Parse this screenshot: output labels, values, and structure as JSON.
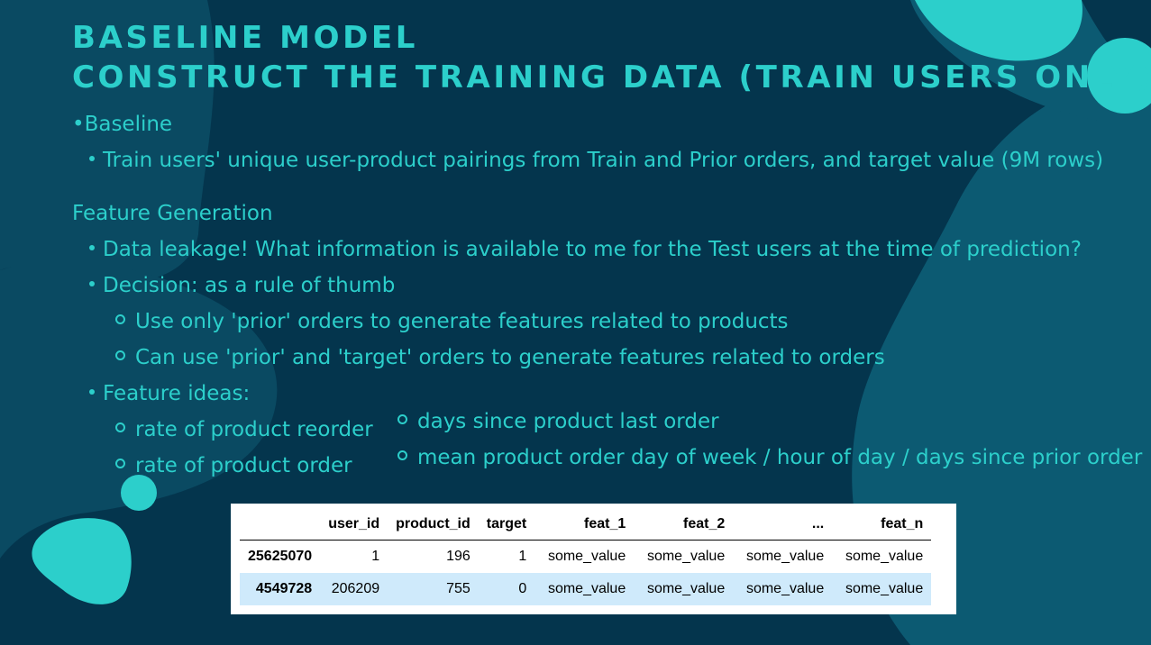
{
  "title": {
    "line1": "BASELINE MODEL",
    "line2": "CONSTRUCT THE TRAINING DATA (TRAIN USERS ONLY)"
  },
  "baseline": {
    "heading": "•Baseline",
    "item": "Train users' unique user-product pairings from Train and Prior orders, and target value (9M rows)"
  },
  "feature_generation": {
    "heading": "Feature Generation",
    "leakage": "Data leakage! What information is available to me for the Test users at the time of prediction?",
    "decision": "Decision: as a rule of thumb",
    "rule1": "Use only 'prior' orders to generate features related to products",
    "rule2": "Can use 'prior' and 'target' orders to generate features related to orders",
    "ideas_label": "Feature ideas:",
    "ideas_left": [
      "rate of product reorder",
      "rate of product order"
    ],
    "ideas_right": [
      "days since product last order",
      "mean product order day of week / hour of day / days since prior order"
    ]
  },
  "table": {
    "headers": [
      "",
      "user_id",
      "product_id",
      "target",
      "feat_1",
      "feat_2",
      "...",
      "feat_n"
    ],
    "rows": [
      [
        "25625070",
        "1",
        "196",
        "1",
        "some_value",
        "some_value",
        "some_value",
        "some_value"
      ],
      [
        "4549728",
        "206209",
        "755",
        "0",
        "some_value",
        "some_value",
        "some_value",
        "some_value"
      ]
    ]
  },
  "colors": {
    "background": "#04354d",
    "accent": "#2ccfcb",
    "blob_mid": "#0b4f66",
    "blob_dark": "#0d6678",
    "row_highlight": "#cfeafb"
  }
}
